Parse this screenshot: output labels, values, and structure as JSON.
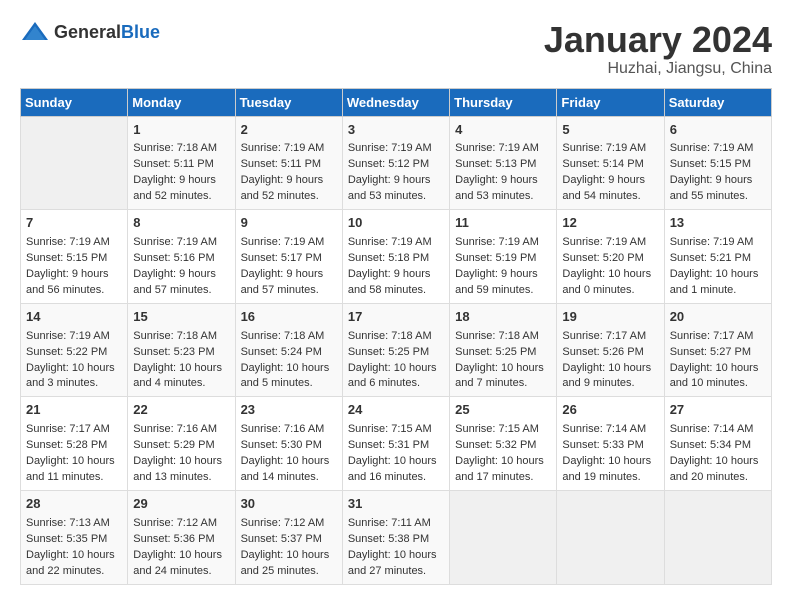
{
  "header": {
    "logo_general": "General",
    "logo_blue": "Blue",
    "month": "January 2024",
    "location": "Huzhai, Jiangsu, China"
  },
  "columns": [
    "Sunday",
    "Monday",
    "Tuesday",
    "Wednesday",
    "Thursday",
    "Friday",
    "Saturday"
  ],
  "weeks": [
    [
      {
        "day": "",
        "info": ""
      },
      {
        "day": "1",
        "info": "Sunrise: 7:18 AM\nSunset: 5:11 PM\nDaylight: 9 hours\nand 52 minutes."
      },
      {
        "day": "2",
        "info": "Sunrise: 7:19 AM\nSunset: 5:11 PM\nDaylight: 9 hours\nand 52 minutes."
      },
      {
        "day": "3",
        "info": "Sunrise: 7:19 AM\nSunset: 5:12 PM\nDaylight: 9 hours\nand 53 minutes."
      },
      {
        "day": "4",
        "info": "Sunrise: 7:19 AM\nSunset: 5:13 PM\nDaylight: 9 hours\nand 53 minutes."
      },
      {
        "day": "5",
        "info": "Sunrise: 7:19 AM\nSunset: 5:14 PM\nDaylight: 9 hours\nand 54 minutes."
      },
      {
        "day": "6",
        "info": "Sunrise: 7:19 AM\nSunset: 5:15 PM\nDaylight: 9 hours\nand 55 minutes."
      }
    ],
    [
      {
        "day": "7",
        "info": "Sunrise: 7:19 AM\nSunset: 5:15 PM\nDaylight: 9 hours\nand 56 minutes."
      },
      {
        "day": "8",
        "info": "Sunrise: 7:19 AM\nSunset: 5:16 PM\nDaylight: 9 hours\nand 57 minutes."
      },
      {
        "day": "9",
        "info": "Sunrise: 7:19 AM\nSunset: 5:17 PM\nDaylight: 9 hours\nand 57 minutes."
      },
      {
        "day": "10",
        "info": "Sunrise: 7:19 AM\nSunset: 5:18 PM\nDaylight: 9 hours\nand 58 minutes."
      },
      {
        "day": "11",
        "info": "Sunrise: 7:19 AM\nSunset: 5:19 PM\nDaylight: 9 hours\nand 59 minutes."
      },
      {
        "day": "12",
        "info": "Sunrise: 7:19 AM\nSunset: 5:20 PM\nDaylight: 10 hours\nand 0 minutes."
      },
      {
        "day": "13",
        "info": "Sunrise: 7:19 AM\nSunset: 5:21 PM\nDaylight: 10 hours\nand 1 minute."
      }
    ],
    [
      {
        "day": "14",
        "info": "Sunrise: 7:19 AM\nSunset: 5:22 PM\nDaylight: 10 hours\nand 3 minutes."
      },
      {
        "day": "15",
        "info": "Sunrise: 7:18 AM\nSunset: 5:23 PM\nDaylight: 10 hours\nand 4 minutes."
      },
      {
        "day": "16",
        "info": "Sunrise: 7:18 AM\nSunset: 5:24 PM\nDaylight: 10 hours\nand 5 minutes."
      },
      {
        "day": "17",
        "info": "Sunrise: 7:18 AM\nSunset: 5:25 PM\nDaylight: 10 hours\nand 6 minutes."
      },
      {
        "day": "18",
        "info": "Sunrise: 7:18 AM\nSunset: 5:25 PM\nDaylight: 10 hours\nand 7 minutes."
      },
      {
        "day": "19",
        "info": "Sunrise: 7:17 AM\nSunset: 5:26 PM\nDaylight: 10 hours\nand 9 minutes."
      },
      {
        "day": "20",
        "info": "Sunrise: 7:17 AM\nSunset: 5:27 PM\nDaylight: 10 hours\nand 10 minutes."
      }
    ],
    [
      {
        "day": "21",
        "info": "Sunrise: 7:17 AM\nSunset: 5:28 PM\nDaylight: 10 hours\nand 11 minutes."
      },
      {
        "day": "22",
        "info": "Sunrise: 7:16 AM\nSunset: 5:29 PM\nDaylight: 10 hours\nand 13 minutes."
      },
      {
        "day": "23",
        "info": "Sunrise: 7:16 AM\nSunset: 5:30 PM\nDaylight: 10 hours\nand 14 minutes."
      },
      {
        "day": "24",
        "info": "Sunrise: 7:15 AM\nSunset: 5:31 PM\nDaylight: 10 hours\nand 16 minutes."
      },
      {
        "day": "25",
        "info": "Sunrise: 7:15 AM\nSunset: 5:32 PM\nDaylight: 10 hours\nand 17 minutes."
      },
      {
        "day": "26",
        "info": "Sunrise: 7:14 AM\nSunset: 5:33 PM\nDaylight: 10 hours\nand 19 minutes."
      },
      {
        "day": "27",
        "info": "Sunrise: 7:14 AM\nSunset: 5:34 PM\nDaylight: 10 hours\nand 20 minutes."
      }
    ],
    [
      {
        "day": "28",
        "info": "Sunrise: 7:13 AM\nSunset: 5:35 PM\nDaylight: 10 hours\nand 22 minutes."
      },
      {
        "day": "29",
        "info": "Sunrise: 7:12 AM\nSunset: 5:36 PM\nDaylight: 10 hours\nand 24 minutes."
      },
      {
        "day": "30",
        "info": "Sunrise: 7:12 AM\nSunset: 5:37 PM\nDaylight: 10 hours\nand 25 minutes."
      },
      {
        "day": "31",
        "info": "Sunrise: 7:11 AM\nSunset: 5:38 PM\nDaylight: 10 hours\nand 27 minutes."
      },
      {
        "day": "",
        "info": ""
      },
      {
        "day": "",
        "info": ""
      },
      {
        "day": "",
        "info": ""
      }
    ]
  ]
}
